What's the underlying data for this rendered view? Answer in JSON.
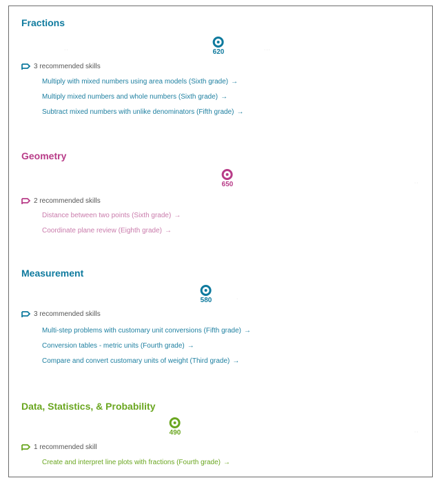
{
  "sections": [
    {
      "title": "Fractions",
      "color": "#0e7a9e",
      "score": "620",
      "recommended": "3 recommended skills",
      "skills": [
        "Multiply with mixed numbers using area models (Sixth grade)",
        "Multiply mixed numbers and whole numbers (Sixth grade)",
        "Subtract mixed numbers with unlike denominators (Fifth grade)"
      ]
    },
    {
      "title": "Geometry",
      "color": "#b83c88",
      "score": "650",
      "recommended": "2 recommended skills",
      "skills": [
        "Distance between two points (Sixth grade)",
        "Coordinate plane review (Eighth grade)"
      ]
    },
    {
      "title": "Measurement",
      "color": "#0e7a9e",
      "score": "580",
      "recommended": "3 recommended skills",
      "skills": [
        "Multi-step problems with customary unit conversions (Fifth grade)",
        "Conversion tables - metric units (Fourth grade)",
        "Compare and convert customary units of weight (Third grade)"
      ]
    },
    {
      "title": "Data, Statistics, & Probability",
      "color": "#6aa620",
      "score": "490",
      "recommended": "1 recommended skill",
      "skills": [
        "Create and interpret line plots with fractions (Fourth grade)"
      ]
    }
  ],
  "arrow_glyph": "→"
}
